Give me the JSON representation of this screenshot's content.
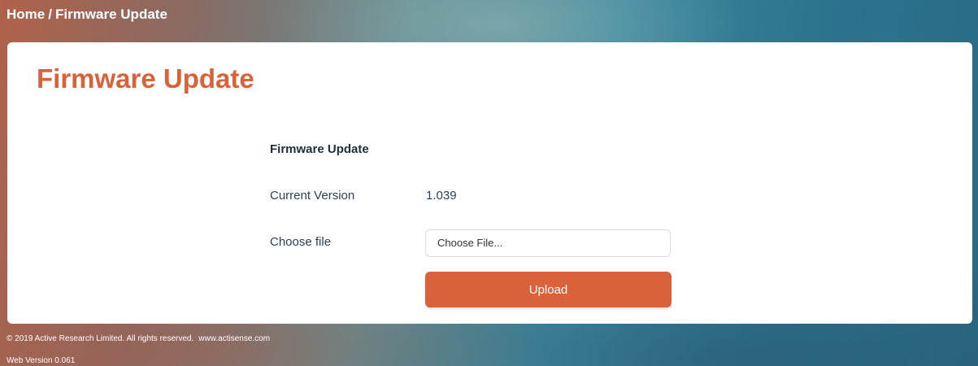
{
  "breadcrumb": {
    "home": "Home",
    "separator": "/",
    "current": "Firmware Update"
  },
  "page": {
    "title": "Firmware Update"
  },
  "form": {
    "section_title": "Firmware Update",
    "current_version_label": "Current Version",
    "current_version_value": "1.039",
    "choose_file_label": "Choose file",
    "file_input_text": "Choose File...",
    "upload_label": "Upload"
  },
  "footer": {
    "copyright": "© 2019 Active Research Limited. All rights reserved.",
    "website": "www.actisense.com",
    "web_version": "Web Version 0.061"
  },
  "colors": {
    "accent": "#d9623a",
    "panel_background": "#ffffff",
    "text_dark": "#1f2d3a"
  }
}
